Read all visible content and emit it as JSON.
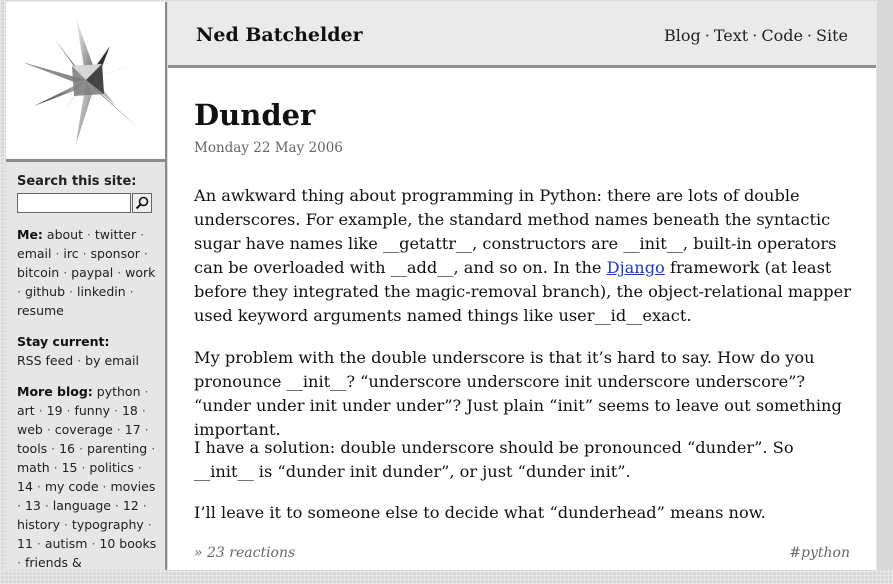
{
  "sidebar": {
    "search_label": "Search this site:",
    "search_value": "",
    "me_label": "Me:",
    "me_links": [
      "about",
      "twitter",
      "email",
      "irc",
      "sponsor",
      "bitcoin",
      "paypal",
      "work",
      "github",
      "linkedin",
      "resume"
    ],
    "stay_label": "Stay current:",
    "stay_links": [
      "RSS feed",
      "by email"
    ],
    "more_label": "More blog:",
    "more_items": [
      "python",
      "art",
      "19",
      "funny",
      "18",
      "web",
      "coverage",
      "17",
      "tools",
      "16",
      "parenting",
      "math",
      "15",
      "politics",
      "14",
      "my code",
      "movies",
      "13",
      "language",
      "12",
      "history",
      "typography",
      "11",
      "autism",
      "10",
      "books",
      "friends &"
    ]
  },
  "header": {
    "site_name": "Ned Batchelder",
    "nav": [
      "Blog",
      "Text",
      "Code",
      "Site"
    ]
  },
  "article": {
    "title": "Dunder",
    "date": "Monday 22 May 2006",
    "p1_before": "An awkward thing about programming in Python: there are lots of double underscores. For example, the standard method names beneath the syntactic sugar have names like __getattr__, constructors are __init__, built-in operators can be overloaded with __add__, and so on. In the ",
    "p1_link": "Django",
    "p1_after": " framework (at least before they integrated the magic-removal branch), the object-relational mapper used keyword arguments named things like user__id__exact.",
    "p2": "My problem with the double underscore is that it’s hard to say. How do you pronounce __init__? “underscore underscore init underscore underscore”? “under under init under under”? Just plain “init” seems to leave out something important.",
    "p3": "I have a solution: double underscore should be pronounced “dunder”. So __init__ is “dunder init dunder”, or just “dunder init”.",
    "p4": "I’ll leave it to someone else to decide what “dunderhead” means now.",
    "reactions": "» 23 reactions",
    "tag": "#python"
  },
  "colors": {
    "link": "#1a39c4",
    "topbar_bg": "#eaeaea",
    "sidebar_bg": "#e6e6e6"
  }
}
